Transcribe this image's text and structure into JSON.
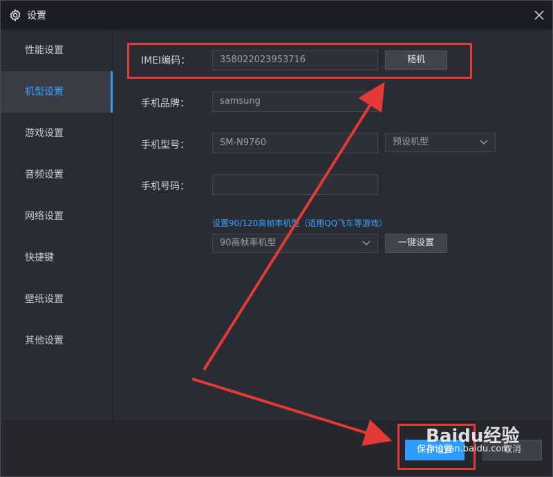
{
  "window": {
    "title": "设置"
  },
  "sidebar": {
    "items": [
      {
        "label": "性能设置",
        "active": false
      },
      {
        "label": "机型设置",
        "active": true
      },
      {
        "label": "游戏设置",
        "active": false
      },
      {
        "label": "音频设置",
        "active": false
      },
      {
        "label": "网络设置",
        "active": false
      },
      {
        "label": "快捷键",
        "active": false
      },
      {
        "label": "壁纸设置",
        "active": false
      },
      {
        "label": "其他设置",
        "active": false
      }
    ]
  },
  "form": {
    "imei": {
      "label": "IMEI编码：",
      "value": "358022023953716",
      "random_button": "随机"
    },
    "brand": {
      "label": "手机品牌：",
      "value": "samsung"
    },
    "model": {
      "label": "手机型号：",
      "value": "SM-N9760",
      "preset_select": "预设机型"
    },
    "phone": {
      "label": "手机号码：",
      "value": ""
    },
    "high_fps": {
      "hint": "设置90/120高帧率机型（适用QQ飞车等游戏）",
      "select": "90高帧率机型",
      "apply_button": "一键设置"
    }
  },
  "footer": {
    "save_button": "保存设置",
    "cancel_button": "取消"
  },
  "watermark": {
    "logo": "Baidu经验",
    "url": "jingyan.baidu.com"
  },
  "colors": {
    "accent": "#2f9bff",
    "annotation": "#e53935",
    "background": "#2a2c33"
  }
}
